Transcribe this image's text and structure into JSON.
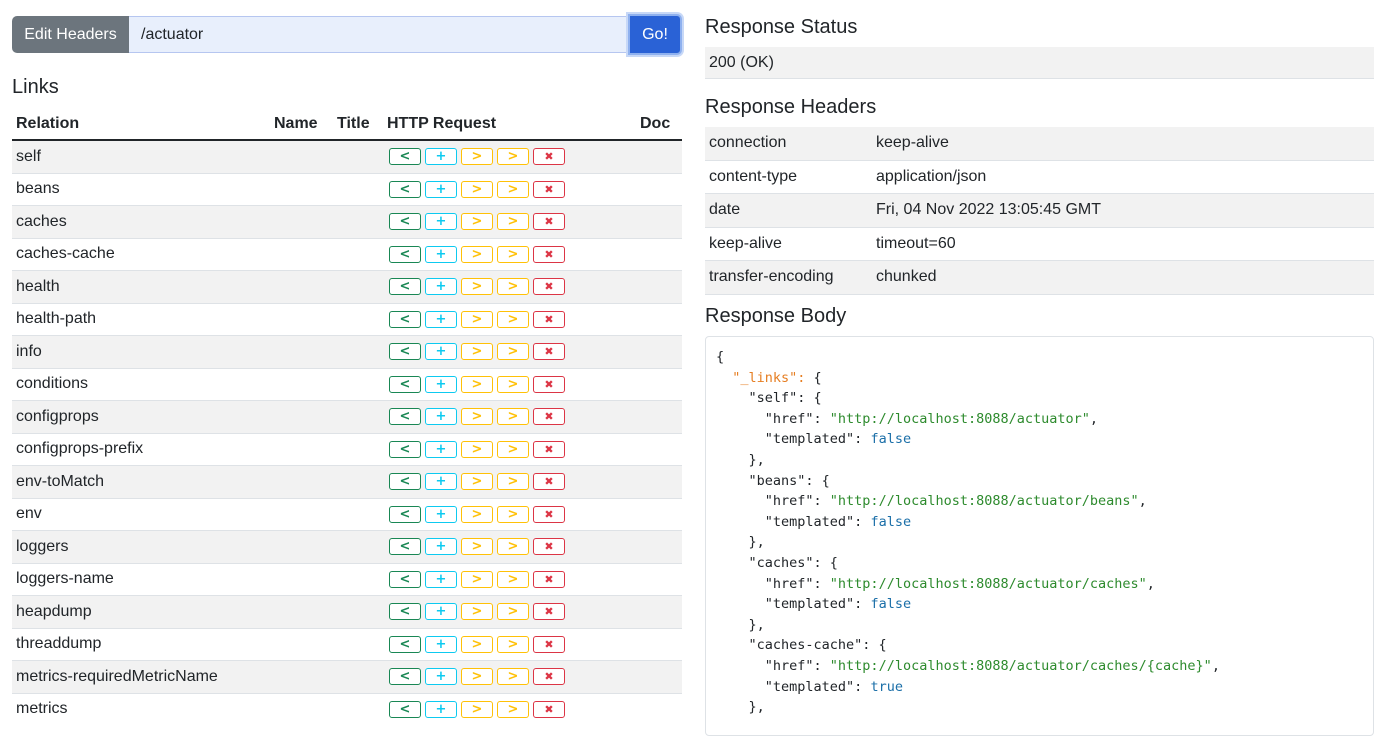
{
  "request": {
    "edit_headers_label": "Edit Headers",
    "url_value": "/actuator",
    "go_label": "Go!"
  },
  "links": {
    "title": "Links",
    "columns": [
      "Relation",
      "Name",
      "Title",
      "HTTP Request",
      "Doc"
    ],
    "rows": [
      {
        "relation": "self"
      },
      {
        "relation": "beans"
      },
      {
        "relation": "caches"
      },
      {
        "relation": "caches-cache"
      },
      {
        "relation": "health"
      },
      {
        "relation": "health-path"
      },
      {
        "relation": "info"
      },
      {
        "relation": "conditions"
      },
      {
        "relation": "configprops"
      },
      {
        "relation": "configprops-prefix"
      },
      {
        "relation": "env-toMatch"
      },
      {
        "relation": "env"
      },
      {
        "relation": "loggers"
      },
      {
        "relation": "loggers-name"
      },
      {
        "relation": "heapdump"
      },
      {
        "relation": "threaddump"
      },
      {
        "relation": "metrics-requiredMetricName"
      },
      {
        "relation": "metrics"
      }
    ],
    "request_buttons": [
      {
        "method": "get",
        "glyph": "<",
        "color": "#198754"
      },
      {
        "method": "post",
        "glyph": "+",
        "color": "#0dcaf0"
      },
      {
        "method": "put",
        "glyph": ">",
        "color": "#ffc107"
      },
      {
        "method": "patch",
        "glyph": ">",
        "color": "#ffc107"
      },
      {
        "method": "delete",
        "glyph": "✖",
        "color": "#dc3545"
      }
    ]
  },
  "response": {
    "status_title": "Response Status",
    "status_value": "200 (OK)",
    "headers_title": "Response Headers",
    "headers": [
      {
        "name": "connection",
        "value": "keep-alive"
      },
      {
        "name": "content-type",
        "value": "application/json"
      },
      {
        "name": "date",
        "value": "Fri, 04 Nov 2022 13:05:45 GMT"
      },
      {
        "name": "keep-alive",
        "value": "timeout=60"
      },
      {
        "name": "transfer-encoding",
        "value": "chunked"
      }
    ],
    "body_title": "Response Body",
    "body_lines": [
      [
        {
          "t": "{",
          "c": ""
        }
      ],
      [
        {
          "t": "  ",
          "c": ""
        },
        {
          "t": "\"_links\": ",
          "c": "k-top"
        },
        {
          "t": "{",
          "c": ""
        }
      ],
      [
        {
          "t": "    \"self\": {",
          "c": ""
        }
      ],
      [
        {
          "t": "      \"href\": ",
          "c": ""
        },
        {
          "t": "\"http://localhost:8088/actuator\"",
          "c": "str"
        },
        {
          "t": ",",
          "c": ""
        }
      ],
      [
        {
          "t": "      \"templated\": ",
          "c": ""
        },
        {
          "t": "false",
          "c": "bool"
        }
      ],
      [
        {
          "t": "    },",
          "c": ""
        }
      ],
      [
        {
          "t": "    \"beans\": {",
          "c": ""
        }
      ],
      [
        {
          "t": "      \"href\": ",
          "c": ""
        },
        {
          "t": "\"http://localhost:8088/actuator/beans\"",
          "c": "str"
        },
        {
          "t": ",",
          "c": ""
        }
      ],
      [
        {
          "t": "      \"templated\": ",
          "c": ""
        },
        {
          "t": "false",
          "c": "bool"
        }
      ],
      [
        {
          "t": "    },",
          "c": ""
        }
      ],
      [
        {
          "t": "    \"caches\": {",
          "c": ""
        }
      ],
      [
        {
          "t": "      \"href\": ",
          "c": ""
        },
        {
          "t": "\"http://localhost:8088/actuator/caches\"",
          "c": "str"
        },
        {
          "t": ",",
          "c": ""
        }
      ],
      [
        {
          "t": "      \"templated\": ",
          "c": ""
        },
        {
          "t": "false",
          "c": "bool"
        }
      ],
      [
        {
          "t": "    },",
          "c": ""
        }
      ],
      [
        {
          "t": "    \"caches-cache\": {",
          "c": ""
        }
      ],
      [
        {
          "t": "      \"href\": ",
          "c": ""
        },
        {
          "t": "\"http://localhost:8088/actuator/caches/{cache}\"",
          "c": "str"
        },
        {
          "t": ",",
          "c": ""
        }
      ],
      [
        {
          "t": "      \"templated\": ",
          "c": ""
        },
        {
          "t": "true",
          "c": "bool"
        }
      ],
      [
        {
          "t": "    },",
          "c": ""
        }
      ]
    ]
  }
}
